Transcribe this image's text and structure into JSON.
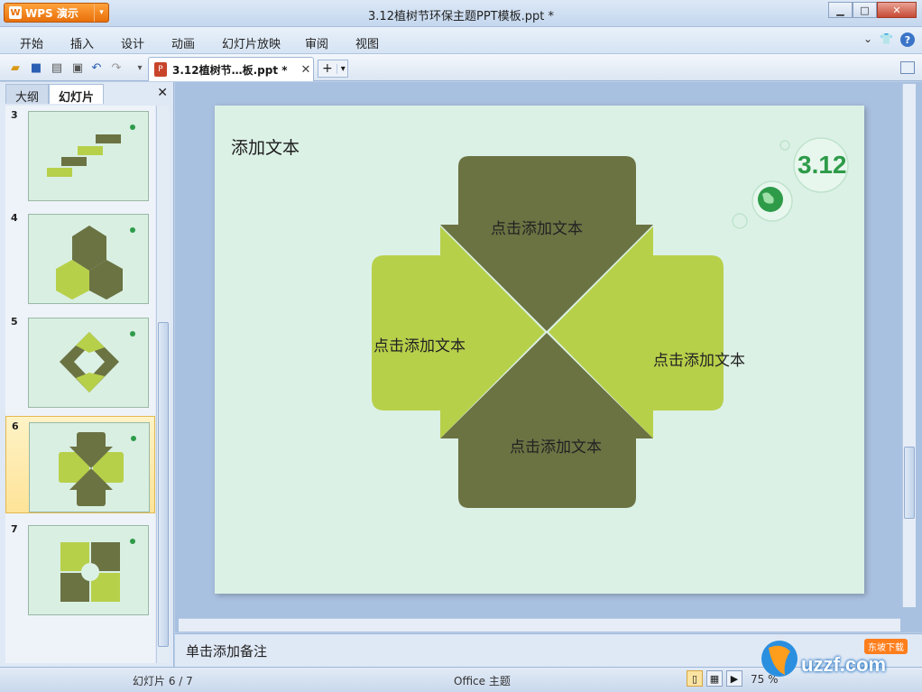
{
  "app": {
    "name": "WPS 演示",
    "window_title": "3.12植树节环保主题PPT模板.ppt *"
  },
  "window_controls": {
    "minimize": "▁",
    "maximize": "□",
    "close": "✕"
  },
  "menu": [
    "开始",
    "插入",
    "设计",
    "动画",
    "幻灯片放映",
    "审阅",
    "视图"
  ],
  "toolbar": {
    "doc_tab_name": "3.12植树节…板.ppt *",
    "close_tab": "✕",
    "new_tab": "+",
    "new_tab_drop": "▾"
  },
  "left_panel": {
    "tabs": [
      "大纲",
      "幻灯片"
    ],
    "close": "✕",
    "slides": [
      {
        "num": "3"
      },
      {
        "num": "4"
      },
      {
        "num": "5"
      },
      {
        "num": "6",
        "selected": true
      },
      {
        "num": "7"
      }
    ]
  },
  "slide": {
    "title": "添加文本",
    "badge": "3.12",
    "labels": {
      "top": "点击添加文本",
      "left": "点击添加文本",
      "right": "点击添加文本",
      "bottom": "点击添加文本"
    },
    "colors": {
      "dark": "#6b7343",
      "light": "#b7d04a",
      "bg": "#dcf1e6"
    }
  },
  "notes": {
    "placeholder": "单击添加备注"
  },
  "status": {
    "slide_count": "幻灯片 6 / 7",
    "theme": "Office 主题",
    "zoom": "75 %"
  },
  "watermark": {
    "text": "uzzf.com",
    "tag": "东坡下载"
  }
}
